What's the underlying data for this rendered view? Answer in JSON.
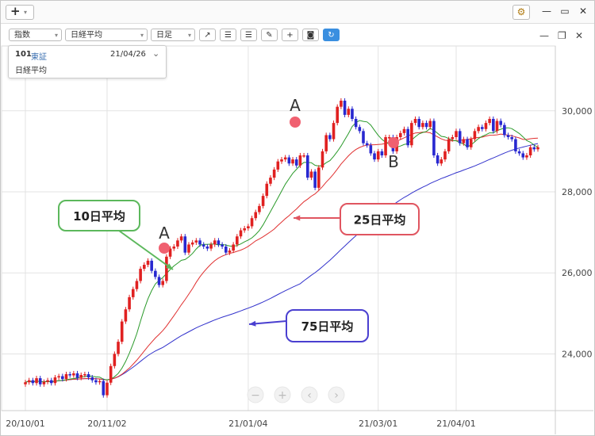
{
  "window": {
    "controls": {
      "minimize": "—",
      "maximize": "▭",
      "close": "✕"
    }
  },
  "toolbar": {
    "type_select": "指数",
    "symbol_select": "日経平均",
    "period_select": "日足",
    "buttons": [
      "trend-line",
      "align-left",
      "align-right",
      "pencil",
      "crosshair",
      "camera",
      "refresh"
    ]
  },
  "info": {
    "code": "101",
    "exchange": "東証",
    "date": "21/04/26",
    "name": "日経平均"
  },
  "chart_data": {
    "type": "candlestick",
    "ylim": [
      22600,
      31600
    ],
    "y_ticks": [
      "24,000",
      "26,000",
      "28,000",
      "30,000"
    ],
    "y_tick_values": [
      24000,
      26000,
      28000,
      30000
    ],
    "x_ticks": [
      "20/10/01",
      "20/11/02",
      "21/01/04",
      "21/03/01",
      "21/04/01"
    ],
    "x_tick_index": [
      0,
      22,
      60,
      95,
      116
    ],
    "n_days": 139,
    "grid": true,
    "colors": {
      "up": "#e02020",
      "down": "#2828d0",
      "ma10": "#2a9a2a",
      "ma25": "#e03030",
      "ma75": "#3333cc"
    },
    "close": [
      23300,
      23350,
      23280,
      23400,
      23250,
      23310,
      23350,
      23280,
      23420,
      23450,
      23380,
      23500,
      23470,
      23520,
      23410,
      23480,
      23500,
      23420,
      23350,
      23300,
      23330,
      22980,
      23290,
      23700,
      24000,
      24300,
      24800,
      25100,
      25400,
      25600,
      25800,
      26100,
      26200,
      26300,
      26050,
      25900,
      25700,
      25800,
      26400,
      26600,
      26650,
      26800,
      26900,
      26500,
      26700,
      26750,
      26800,
      26700,
      26650,
      26600,
      26700,
      26800,
      26700,
      26650,
      26500,
      26550,
      26700,
      26900,
      27050,
      27100,
      27150,
      27350,
      27500,
      27650,
      27900,
      28200,
      28350,
      28550,
      28750,
      28800,
      28850,
      28700,
      28800,
      28650,
      28900,
      28900,
      28350,
      28500,
      28100,
      28600,
      29000,
      29400,
      29300,
      29700,
      30100,
      30250,
      29900,
      30050,
      29800,
      29600,
      29500,
      29200,
      29150,
      28950,
      28800,
      29000,
      28900,
      29350,
      29350,
      29000,
      29350,
      29450,
      29550,
      29150,
      29700,
      29800,
      29600,
      29700,
      29600,
      29750,
      28900,
      28700,
      28800,
      29000,
      29300,
      29350,
      29500,
      29200,
      29300,
      29100,
      29300,
      29500,
      29600,
      29550,
      29700,
      29800,
      29500,
      29750,
      29650,
      29400,
      29350,
      29300,
      29000,
      28950,
      28850,
      28900,
      29100,
      29050,
      29100
    ],
    "open": [
      23250,
      23300,
      23350,
      23280,
      23400,
      23250,
      23310,
      23350,
      23280,
      23420,
      23450,
      23380,
      23500,
      23470,
      23520,
      23410,
      23480,
      23500,
      23420,
      23350,
      23300,
      23330,
      22980,
      23290,
      23700,
      24000,
      24300,
      24800,
      25100,
      25400,
      25600,
      25800,
      26100,
      26200,
      26300,
      26050,
      25900,
      25700,
      25800,
      26400,
      26600,
      26650,
      26800,
      26900,
      26500,
      26700,
      26750,
      26800,
      26700,
      26650,
      26600,
      26700,
      26800,
      26700,
      26650,
      26500,
      26550,
      26700,
      26900,
      27050,
      27100,
      27150,
      27350,
      27500,
      27650,
      27900,
      28200,
      28350,
      28550,
      28750,
      28800,
      28850,
      28700,
      28800,
      28650,
      28900,
      28900,
      28350,
      28500,
      28100,
      28600,
      29000,
      29400,
      29300,
      29700,
      30100,
      30250,
      29900,
      30050,
      29800,
      29600,
      29500,
      29200,
      29150,
      28950,
      28800,
      29000,
      28900,
      29350,
      29350,
      29000,
      29350,
      29450,
      29550,
      29150,
      29700,
      29800,
      29600,
      29700,
      29600,
      29750,
      28900,
      28700,
      28800,
      29000,
      29300,
      29350,
      29500,
      29200,
      29300,
      29100,
      29300,
      29500,
      29600,
      29550,
      29700,
      29800,
      29500,
      29750,
      29650,
      29400,
      29350,
      29300,
      29000,
      28950,
      28850,
      28900,
      29100,
      29050
    ],
    "ma10_start": 9,
    "ma25_start": 0,
    "ma75_start": 0
  },
  "annotations": [
    {
      "text": "A",
      "marker": "A-left"
    },
    {
      "text": "A",
      "marker": "A-right"
    },
    {
      "text": "B",
      "marker": "B"
    }
  ],
  "callouts": {
    "ma10": "10日平均",
    "ma25": "25日平均",
    "ma75": "75日平均"
  },
  "nav_controls": [
    "−",
    "+",
    "‹",
    "›"
  ]
}
